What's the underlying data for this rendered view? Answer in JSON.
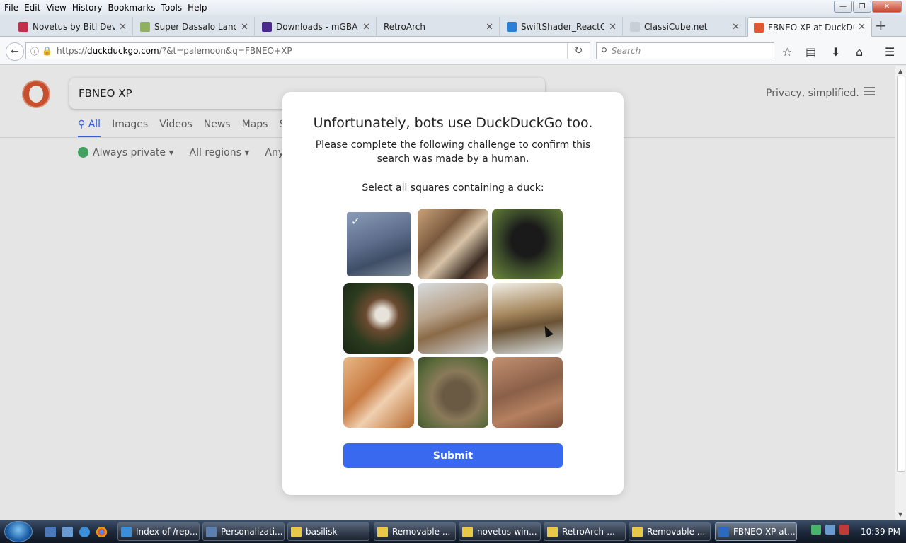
{
  "menu": [
    "File",
    "Edit",
    "View",
    "History",
    "Bookmarks",
    "Tools",
    "Help"
  ],
  "window_controls": {
    "minimize": "—",
    "maximize": "❐",
    "close": "✕"
  },
  "tabs": [
    {
      "label": "Novetus by Bitl Devel",
      "icon_color": "#c0304a",
      "icon": "n-icon"
    },
    {
      "label": "Super Dassalo Land b",
      "icon_color": "#8fb060",
      "icon": "game-icon"
    },
    {
      "label": "Downloads - mGBA",
      "icon_color": "#4a2a8a",
      "icon": "mgba-icon"
    },
    {
      "label": "RetroArch",
      "icon_color": "",
      "icon": ""
    },
    {
      "label": "SwiftShader_ReactOS",
      "icon_color": "#2d7fd3",
      "icon": "swift-icon"
    },
    {
      "label": "ClassiCube.net",
      "icon_color": "#c9cfd6",
      "icon": "cube-icon"
    },
    {
      "label": "FBNEO XP at DuckDu",
      "icon_color": "#de5833",
      "icon": "duckduckgo-icon"
    }
  ],
  "tab_close": "✕",
  "newtab": "+",
  "nav": {
    "back": "←",
    "url_prefix": "https://",
    "url_domain": "duckduckgo.com",
    "url_rest": "/?&t=palemoon&q=FBNEO+XP",
    "reload": "↻",
    "search_placeholder": "Search",
    "search_icon": "⚲"
  },
  "ddg": {
    "query": "FBNEO XP",
    "tagline": "Privacy, simplified.",
    "tabs": [
      "All",
      "Images",
      "Videos",
      "News",
      "Maps",
      "Sh"
    ],
    "filters": [
      "Always private ▾",
      "All regions ▾",
      "Any ti"
    ]
  },
  "challenge": {
    "title": "Unfortunately, bots use DuckDuckGo too.",
    "subtitle": "Please complete the following challenge to confirm this search was made by a human.",
    "instruction": "Select all squares containing a duck:",
    "submit": "Submit",
    "check": "✓",
    "tiles": [
      {
        "name": "tile-duck-blue",
        "selected": true,
        "bg": "linear-gradient(160deg,#8a9cb8 0%,#5d6d8c 45%,#3f4e66 70%,#7d8c9a 100%)"
      },
      {
        "name": "tile-tiger",
        "selected": false,
        "bg": "linear-gradient(135deg,#c9a27a 0%,#7a5a3e 35%,#d8c3a8 55%,#3a2b22 80%,#a8846a 100%)"
      },
      {
        "name": "tile-gorilla",
        "selected": false,
        "bg": "radial-gradient(circle at 50% 45%,#1a1a1a 30%,#3b4a2a 55%,#6d8a3a 100%)"
      },
      {
        "name": "tile-eagle",
        "selected": false,
        "bg": "radial-gradient(circle at 55% 45%,#e8e3da 12%,#6b4a30 30%,#2a3a1e 60%,#1a2614 100%)"
      },
      {
        "name": "tile-deer",
        "selected": false,
        "bg": "linear-gradient(160deg,#d8dde0 0%,#b8a28a 40%,#8a6a48 60%,#cfd2d4 100%)"
      },
      {
        "name": "tile-duck-mallard",
        "selected": false,
        "bg": "linear-gradient(170deg,#f1efe8 0%,#a88a60 40%,#6a5234 60%,#d9e0e0 100%)"
      },
      {
        "name": "tile-tiger-lying",
        "selected": false,
        "bg": "linear-gradient(135deg,#e8b888 0%,#c87a40 40%,#f0d0b0 60%,#b86a30 100%)"
      },
      {
        "name": "tile-duck-brown",
        "selected": false,
        "bg": "radial-gradient(circle at 55% 55%,#6a5a44 25%,#8a7a5a 45%,#5a6a3a 75%,#3a4a2a 100%)"
      },
      {
        "name": "tile-elephant-baby",
        "selected": false,
        "bg": "linear-gradient(160deg,#c49070 0%,#8a6048 45%,#b48060 70%,#7a5038 100%)"
      }
    ]
  },
  "taskbar": {
    "tasks": [
      {
        "label": "Index of /rep...",
        "icon": "ie-icon",
        "icon_color": "#3b8fd8"
      },
      {
        "label": "Personalizati...",
        "icon": "monitor-icon",
        "icon_color": "#5a7fb0"
      },
      {
        "label": "basilisk",
        "icon": "folder-icon",
        "icon_color": "#e8c84a"
      },
      {
        "label": "Removable ...",
        "icon": "folder-icon",
        "icon_color": "#e8c84a"
      },
      {
        "label": "novetus-win...",
        "icon": "folder-icon",
        "icon_color": "#e8c84a"
      },
      {
        "label": "RetroArch-...",
        "icon": "folder-icon",
        "icon_color": "#e8c84a"
      },
      {
        "label": "Removable ...",
        "icon": "folder-icon",
        "icon_color": "#e8c84a"
      },
      {
        "label": "FBNEO XP at...",
        "icon": "palemoon-icon",
        "icon_color": "#2a6ac0"
      }
    ],
    "clock": "10:39 PM"
  }
}
